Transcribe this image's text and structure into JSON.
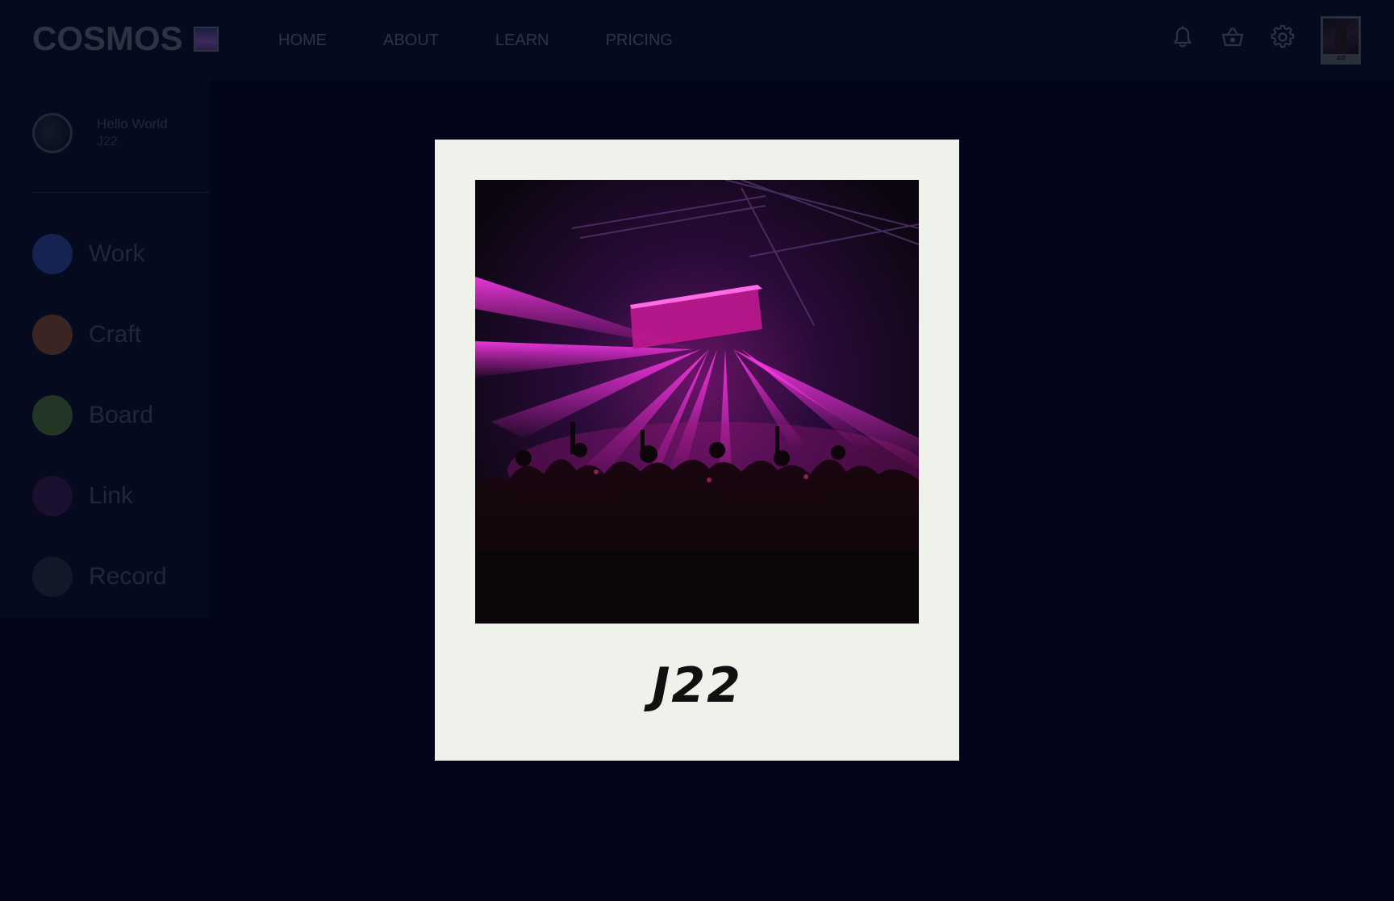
{
  "header": {
    "logo_text": "COSMOS",
    "nav": [
      {
        "label": "HOME"
      },
      {
        "label": "ABOUT"
      },
      {
        "label": "LEARN"
      },
      {
        "label": "PRICING"
      }
    ],
    "icons": [
      "bell-icon",
      "basket-icon",
      "gear-icon"
    ],
    "avatar_caption": "J22"
  },
  "sidebar": {
    "profile": {
      "greeting": "Hello World",
      "handle": "J22"
    },
    "items": [
      {
        "label": "Work",
        "color": "#14234f"
      },
      {
        "label": "Craft",
        "color": "#3a2522"
      },
      {
        "label": "Board",
        "color": "#233524"
      },
      {
        "label": "Link",
        "color": "#1a0f2e"
      },
      {
        "label": "Record",
        "color": "#131828"
      }
    ]
  },
  "polaroid": {
    "caption": "J22",
    "photo_theme": "concert-stage-magenta-lights"
  },
  "colors": {
    "background": "#03061a",
    "polaroid_frame": "#eff2ea",
    "light_beam": "#ff2ad8"
  }
}
